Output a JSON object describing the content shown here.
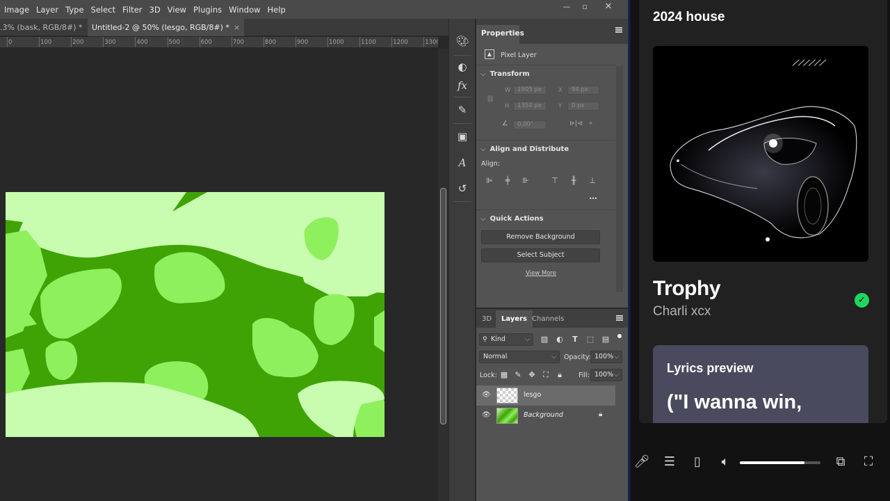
{
  "menu": [
    "Image",
    "Layer",
    "Type",
    "Select",
    "Filter",
    "3D",
    "View",
    "Plugins",
    "Window",
    "Help"
  ],
  "tabs": [
    {
      "label": ".3% (bask, RGB/8#) *",
      "active": false
    },
    {
      "label": "Untitled-2 @ 50% (lesgo, RGB/8#) *",
      "active": true
    }
  ],
  "ruler_ticks": [
    "0",
    "100",
    "200",
    "300",
    "400",
    "500",
    "600",
    "700",
    "800",
    "900",
    "1000",
    "1100",
    "1200",
    "1300"
  ],
  "canvas_colors": {
    "light": "#c8fcaf",
    "mid": "#8ef05d",
    "dark": "#3fa306"
  },
  "properties": {
    "tab": "Properties",
    "layer_type": "Pixel Layer",
    "transform": {
      "title": "Transform",
      "w_label": "W",
      "w_value": "1905 px",
      "x_label": "X",
      "x_value": "94 px",
      "h_label": "H",
      "h_value": "1354 px",
      "y_label": "Y",
      "y_value": "0 px",
      "angle_value": "0.00°"
    },
    "align": {
      "title": "Align and Distribute",
      "label": "Align:",
      "more": "•••"
    },
    "quick_actions": {
      "title": "Quick Actions",
      "remove_bg": "Remove Background",
      "select_subject": "Select Subject",
      "view_more": "View More"
    }
  },
  "layers_panel": {
    "tabs": [
      "3D",
      "Layers",
      "Channels"
    ],
    "filter_kind": "Kind",
    "blend_mode": "Normal",
    "opacity_label": "Opacity:",
    "opacity_value": "100%",
    "lock_label": "Lock:",
    "fill_label": "Fill:",
    "fill_value": "100%",
    "layers": [
      {
        "name": "lesgo",
        "selected": true
      },
      {
        "name": "Background",
        "selected": false
      }
    ]
  },
  "side_panel": {
    "playlist": "2024 house",
    "song": "Trophy",
    "artist": "Charli xcx",
    "lyrics_title": "Lyrics preview",
    "lyrics_line": "(\"I wanna win,",
    "volume": 0.8,
    "accent": "#1ed760"
  }
}
